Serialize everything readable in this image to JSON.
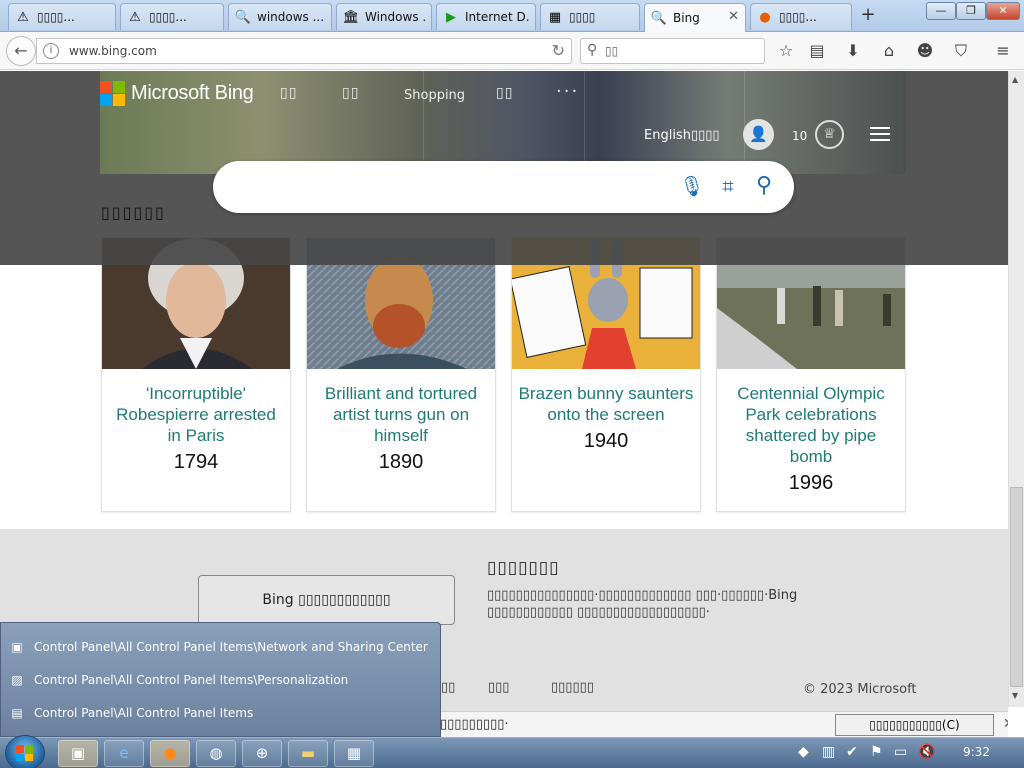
{
  "browser": {
    "tabs": [
      {
        "label": "▯▯▯▯...",
        "icon": "warning-icon"
      },
      {
        "label": "▯▯▯▯...",
        "icon": "warning-icon"
      },
      {
        "label": "windows ...",
        "icon": "search-icon"
      },
      {
        "label": "Windows ...",
        "icon": "library-icon"
      },
      {
        "label": "Internet D...",
        "icon": "play-icon"
      },
      {
        "label": "▯▯▯▯",
        "icon": "page-icon"
      },
      {
        "label": "Bing",
        "icon": "search-icon",
        "active": true
      },
      {
        "label": "▯▯▯▯...",
        "icon": "firefox-icon"
      }
    ],
    "new_tab": "+",
    "window_controls": {
      "minimize": "—",
      "maximize": "❐",
      "close": "✕"
    },
    "url": "www.bing.com",
    "search_placeholder": "▯▯"
  },
  "bing": {
    "logo_text": "Microsoft Bing",
    "logo_colors": [
      "#f25022",
      "#7fba00",
      "#00a4ef",
      "#ffb900"
    ],
    "nav": [
      "▯▯",
      "▯▯",
      "Shopping",
      "▯▯"
    ],
    "more": "···",
    "language": "English▯▯▯▯",
    "points": "10",
    "section_title": "▯▯▯▯▯▯",
    "cards": [
      {
        "title": "'Incorruptible' Robespierre arrested in Paris",
        "year": "1794"
      },
      {
        "title": "Brilliant and tortured artist turns gun on himself",
        "year": "1890"
      },
      {
        "title": "Brazen bunny saunters onto the screen",
        "year": "1940"
      },
      {
        "title": "Centennial Olympic Park celebrations shattered by pipe bomb",
        "year": "1996"
      }
    ],
    "footer": {
      "app_button": "Bing ▯▯▯▯▯▯▯▯▯▯▯▯",
      "heading": "▯▯▯▯▯▯▯",
      "description": "▯▯▯▯▯▯▯▯▯▯▯▯▯▯▯·▯▯▯▯▯▯▯▯▯▯▯▯▯ ▯▯▯·▯▯▯▯▯▯·Bing ▯▯▯▯▯▯▯▯▯▯▯▯ ▯▯▯▯▯▯▯▯▯▯▯▯▯▯▯▯▯▯·",
      "links": [
        "▯▯",
        "▯▯▯",
        "▯▯▯▯▯▯"
      ],
      "copyright": "© 2023 Microsoft",
      "cookie_text": "▯▯▯▯▯▯▯▯▯·",
      "cookie_button": "▯▯▯▯▯▯▯▯▯▯▯(C)",
      "cookie_close": "✕"
    }
  },
  "jumplist": [
    {
      "label": "Control Panel\\All Control Panel Items\\Network and Sharing Center",
      "icon": "network-icon"
    },
    {
      "label": "Control Panel\\All Control Panel Items\\Personalization",
      "icon": "personalization-icon"
    },
    {
      "label": "Control Panel\\All Control Panel Items",
      "icon": "control-panel-icon"
    }
  ],
  "taskbar": {
    "clock": "9:32"
  }
}
